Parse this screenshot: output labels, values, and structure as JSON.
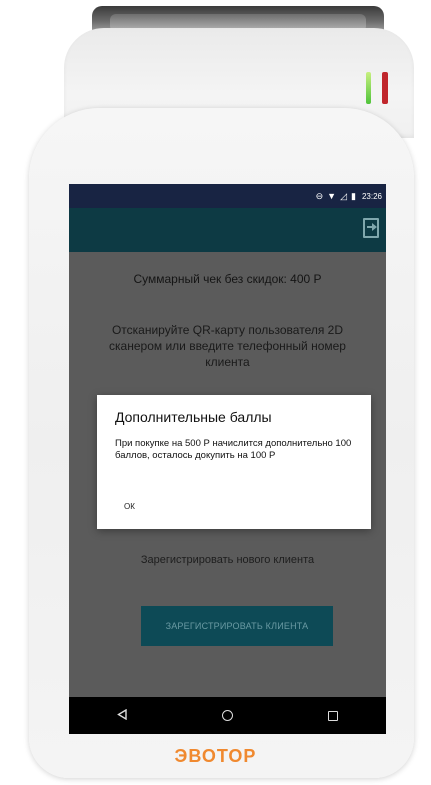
{
  "status_bar": {
    "icons": [
      "minus-circle-icon",
      "wifi-icon",
      "signal-icon",
      "battery-icon"
    ],
    "time": "23:26"
  },
  "app_bar": {
    "exit_icon": "exit-icon"
  },
  "main": {
    "summary": "Суммарный чек без скидок: 400 Р",
    "instruction": "Отсканируйте QR-карту пользователя 2D сканером или введите телефонный номер клиента",
    "register_link": "Зарегистрировать нового клиента",
    "register_button": "ЗАРЕГИСТРИРОВАТЬ КЛИЕНТА"
  },
  "dialog": {
    "title": "Дополнительные баллы",
    "body": "При покупке на 500 Р начислится дополнительно 100 баллов, осталось докупить на 100 Р",
    "ok": "ОК"
  },
  "nav": {
    "back_icon": "back-icon",
    "home_icon": "home-icon",
    "recents_icon": "recents-icon"
  },
  "brand": "ЭВОТОР",
  "colors": {
    "status_bar": "#182443",
    "app_bar": "#0d3a44",
    "overlay": "#5b5b5b",
    "button": "#0d4a56",
    "brand": "#f0892f"
  }
}
